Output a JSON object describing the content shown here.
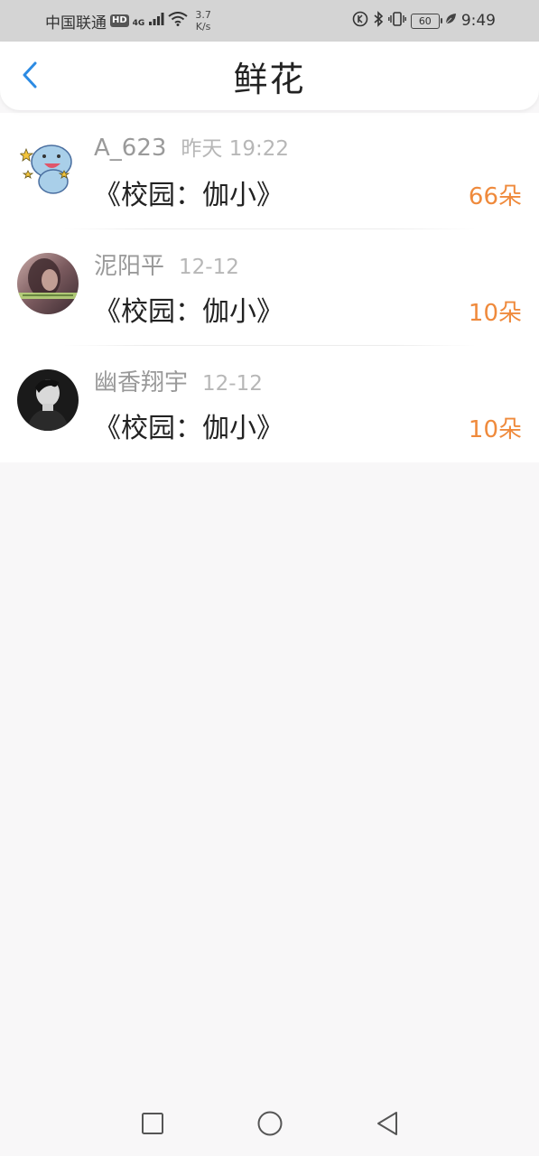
{
  "status_bar": {
    "carrier": "中国联通",
    "hd": "HD",
    "network": "4G",
    "speed_value": "3.7",
    "speed_unit": "K/s",
    "battery": "60",
    "time": "9:49"
  },
  "header": {
    "title": "鲜花"
  },
  "items": [
    {
      "user": "A_623",
      "time": "昨天 19:22",
      "book": "《校园：伽小》",
      "count": "66朵"
    },
    {
      "user": "泥阳平",
      "time": "12-12",
      "book": "《校园：伽小》",
      "count": "10朵"
    },
    {
      "user": "幽香翔宇",
      "time": "12-12",
      "book": "《校园：伽小》",
      "count": "10朵"
    }
  ],
  "colors": {
    "accent_count": "#ef8a3c",
    "back_arrow": "#2c8be3",
    "page_bg": "#f8f7f8"
  }
}
